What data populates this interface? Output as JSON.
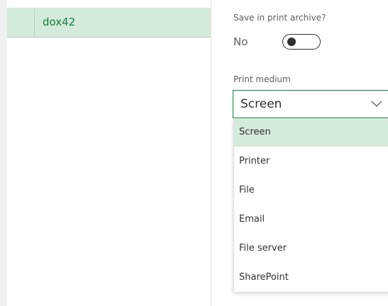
{
  "grid": {
    "selected_cell": "dox42"
  },
  "archive": {
    "label": "Save in print archive?",
    "value": "No"
  },
  "print_medium": {
    "label": "Print medium",
    "value": "Screen",
    "options": [
      "Screen",
      "Printer",
      "File",
      "Email",
      "File server",
      "SharePoint"
    ],
    "selected_index": 0
  },
  "colors": {
    "accent": "#107c41",
    "selected_bg": "#d4eadb"
  }
}
